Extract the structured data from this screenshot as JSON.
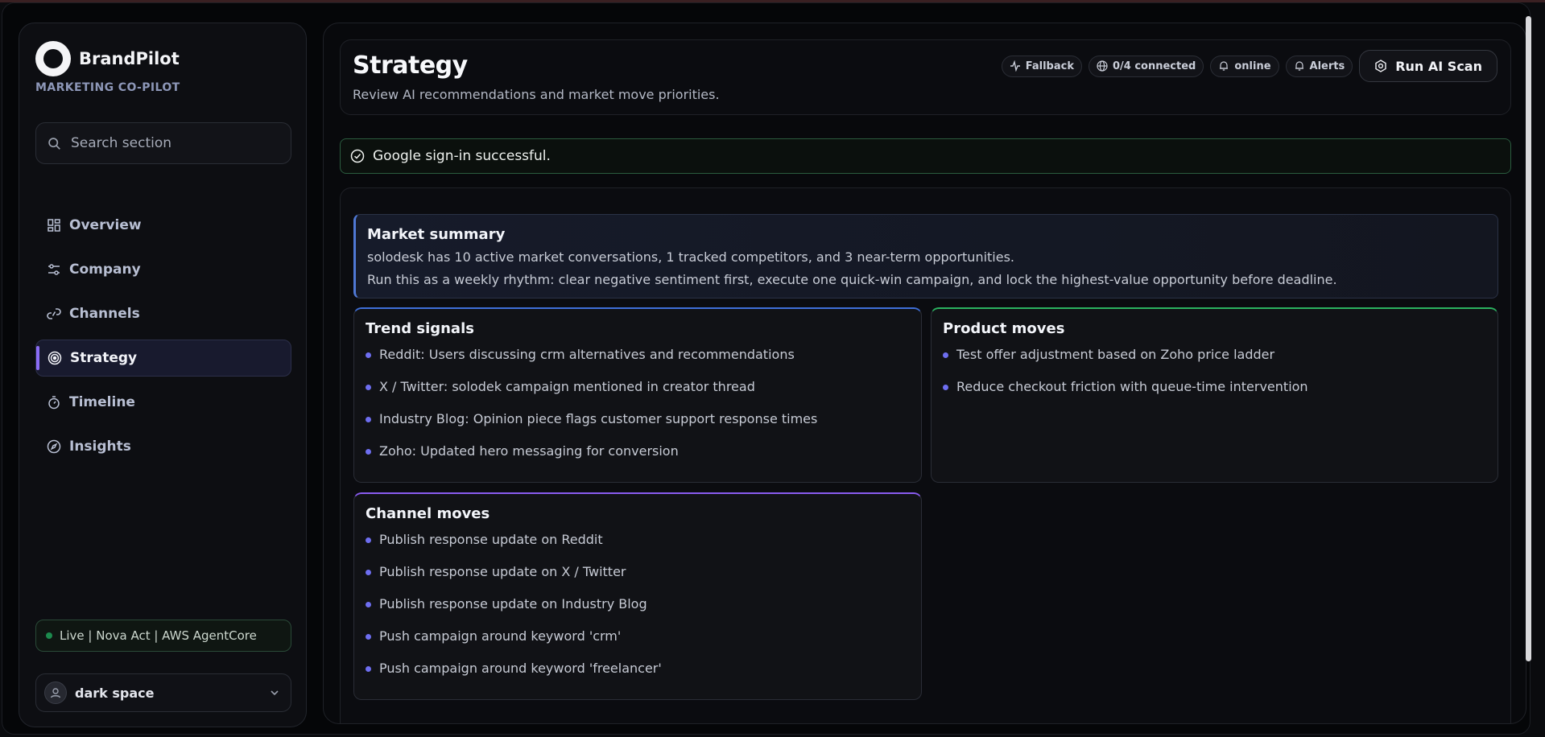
{
  "brand": {
    "name": "BrandPilot",
    "subtitle": "MARKETING CO-PILOT"
  },
  "search": {
    "placeholder": "Search section"
  },
  "nav": {
    "items": [
      {
        "label": "Overview",
        "icon": "grid-icon"
      },
      {
        "label": "Company",
        "icon": "sliders-icon"
      },
      {
        "label": "Channels",
        "icon": "link-icon"
      },
      {
        "label": "Strategy",
        "icon": "target-icon",
        "active": true
      },
      {
        "label": "Timeline",
        "icon": "stopwatch-icon"
      },
      {
        "label": "Insights",
        "icon": "compass-icon"
      }
    ]
  },
  "status": {
    "text": "Live | Nova Act | AWS AgentCore",
    "color": "#1c8a4d"
  },
  "user": {
    "name": "dark space"
  },
  "header": {
    "title": "Strategy",
    "subtitle": "Review AI recommendations and market move priorities.",
    "chips": {
      "fallback": "Fallback",
      "connected": "0/4 connected",
      "online": "online",
      "alerts": "Alerts"
    },
    "run_button": "Run AI Scan"
  },
  "toast": {
    "text": "Google sign-in successful."
  },
  "summary": {
    "title": "Market summary",
    "line1": "solodesk has 10 active market conversations, 1 tracked competitors, and 3 near-term opportunities.",
    "line2": "Run this as a weekly rhythm: clear negative sentiment first, execute one quick-win campaign, and lock the highest-value opportunity before deadline."
  },
  "trend": {
    "title": "Trend signals",
    "items": [
      "Reddit: Users discussing crm alternatives and recommendations",
      "X / Twitter: solodek campaign mentioned in creator thread",
      "Industry Blog: Opinion piece flags customer support response times",
      "Zoho: Updated hero messaging for conversion"
    ]
  },
  "product": {
    "title": "Product moves",
    "items": [
      "Test offer adjustment based on Zoho price ladder",
      "Reduce checkout friction with queue-time intervention"
    ]
  },
  "channel": {
    "title": "Channel moves",
    "items": [
      "Publish response update on Reddit",
      "Publish response update on X / Twitter",
      "Publish response update on Industry Blog",
      "Push campaign around keyword 'crm'",
      "Push campaign around keyword 'freelancer'"
    ]
  },
  "colors": {
    "accent": "#8a6cf5",
    "trend_border": "#3f6fd8",
    "product_border": "#2bb360",
    "channel_border": "#8a5cf0",
    "bullet": "#6e6ef0"
  }
}
